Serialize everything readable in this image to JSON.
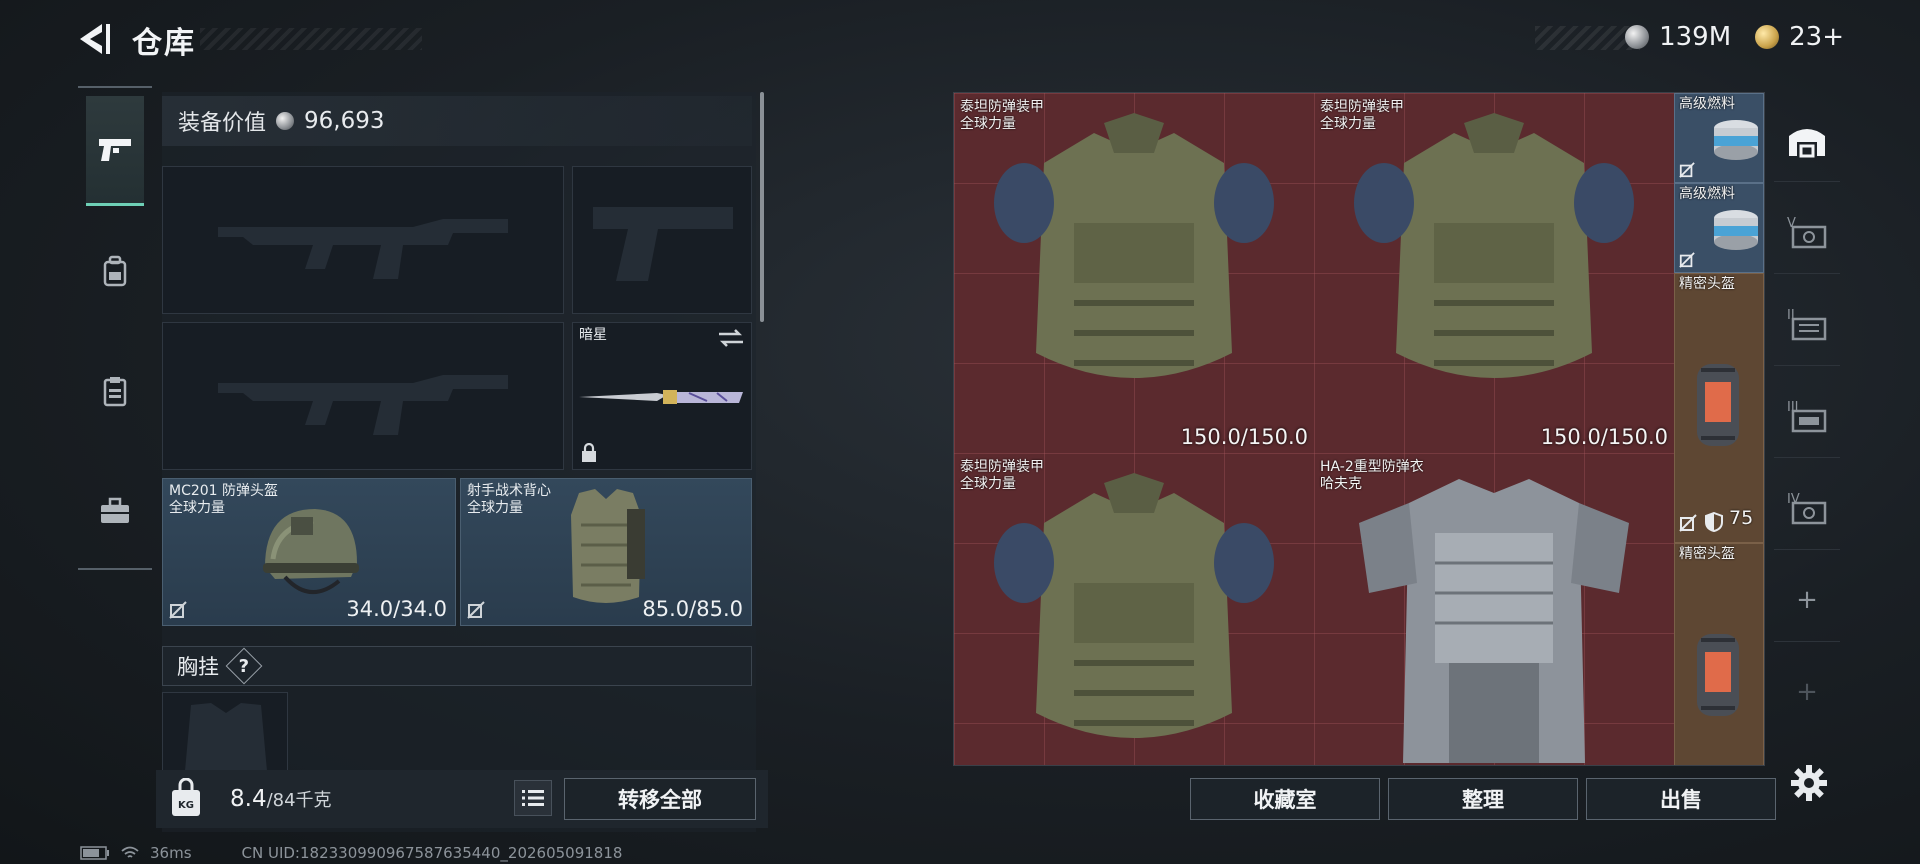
{
  "header": {
    "title": "仓库",
    "currency": [
      {
        "icon": "silver-coin-icon",
        "value": "139M"
      },
      {
        "icon": "gold-token-icon",
        "value": "23+"
      }
    ]
  },
  "left_nav": {
    "items": [
      {
        "icon": "pistol-icon",
        "active": true
      },
      {
        "icon": "backpack-icon",
        "active": false
      },
      {
        "icon": "clipboard-icon",
        "active": false
      },
      {
        "icon": "briefcase-icon",
        "active": false
      }
    ]
  },
  "equipment": {
    "value_label": "装备价值",
    "value": "96,693",
    "slots": {
      "primary_weapon_1": {
        "name": "",
        "empty": true
      },
      "sidearm": {
        "name": "",
        "empty": true
      },
      "primary_weapon_2": {
        "name": "",
        "empty": true
      },
      "melee": {
        "name": "暗星",
        "locked": true
      },
      "helmet": {
        "name": "MC201 防弹头盔",
        "brand": "全球力量",
        "durability": "34.0/34.0"
      },
      "body_armor": {
        "name": "射手战术背心",
        "brand": "全球力量",
        "durability": "85.0/85.0"
      }
    },
    "chest_rig_label": "胸挂",
    "chest_rig_help": "?"
  },
  "weight": {
    "icon_label": "KG",
    "current": "8.4",
    "max": "/84千克"
  },
  "buttons": {
    "transfer_all": "转移全部",
    "collection": "收藏室",
    "organize": "整理",
    "sell": "出售"
  },
  "storage": {
    "items": [
      {
        "name": "泰坦防弹装甲",
        "brand": "全球力量",
        "durability": "150.0/150.0"
      },
      {
        "name": "泰坦防弹装甲",
        "brand": "全球力量",
        "durability": "150.0/150.0"
      },
      {
        "name": "泰坦防弹装甲",
        "brand": "全球力量",
        "durability": ""
      },
      {
        "name": "HA-2重型防弹衣",
        "brand": "哈夫克",
        "durability": ""
      }
    ],
    "side_items": [
      {
        "name": "高级燃料"
      },
      {
        "name": "高级燃料"
      },
      {
        "name": "精密头盔"
      },
      {
        "name": "精密头盔"
      }
    ],
    "side_badge_value": "75"
  },
  "right_tabs": [
    {
      "icon": "warehouse-icon",
      "label": "",
      "active": true
    },
    {
      "icon": "storage-v-icon",
      "label": "V"
    },
    {
      "icon": "storage-ii-icon",
      "label": "II"
    },
    {
      "icon": "storage-iii-icon",
      "label": "III"
    },
    {
      "icon": "storage-iv-icon",
      "label": "IV"
    },
    {
      "icon": "add-icon",
      "label": "+"
    },
    {
      "icon": "add-icon",
      "label": "+"
    }
  ],
  "status": {
    "ping": "36ms",
    "uid": "CN UID:182330990967587635440_202605091818"
  },
  "colors": {
    "accent": "#6ed0b6",
    "storage_bg": "#5b2a2e",
    "equipped_slot": "#33485b"
  }
}
